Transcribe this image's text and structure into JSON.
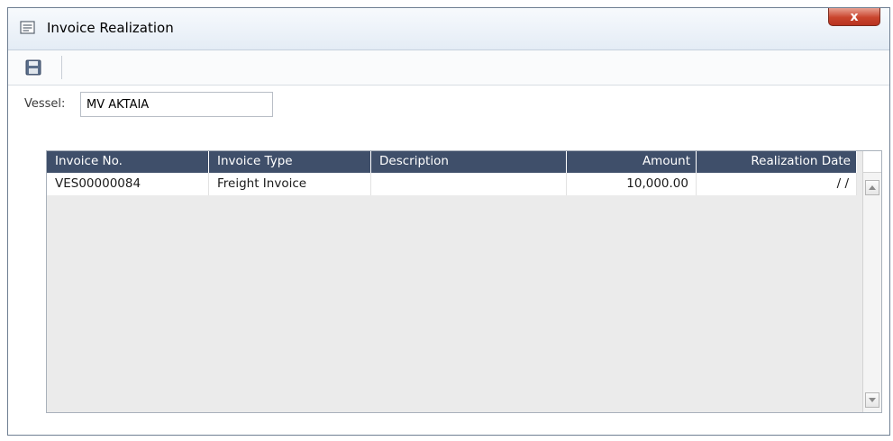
{
  "window": {
    "title": "Invoice Realization",
    "close_label": "x"
  },
  "toolbar": {
    "save_icon": "save-icon"
  },
  "form": {
    "vessel_label": "Vessel:",
    "vessel_value": "MV AKTAIA"
  },
  "grid": {
    "columns": [
      "Invoice No.",
      "Invoice Type",
      "Description",
      "Amount",
      "Realization Date"
    ],
    "rows": [
      {
        "invoice_no": "VES00000084",
        "invoice_type": "Freight Invoice",
        "description": "",
        "amount": "10,000.00",
        "realization_date": "/ /"
      }
    ]
  },
  "colors": {
    "header_bg": "#3f4f6a",
    "close_red": "#c9452d"
  }
}
